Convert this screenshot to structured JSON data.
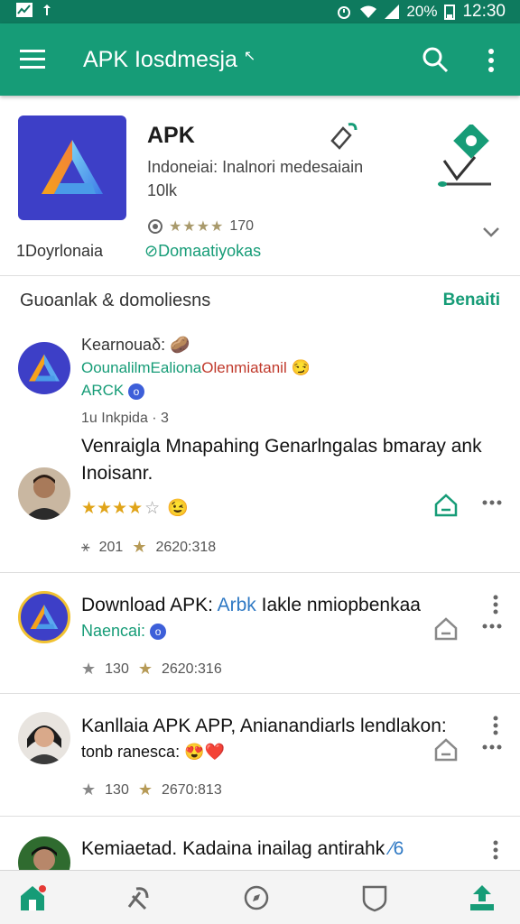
{
  "status": {
    "battery": "20%",
    "time": "12:30"
  },
  "appbar": {
    "title": "APK Iosdmesja",
    "title_mark": "↖"
  },
  "app_card": {
    "name": "APK",
    "subtitle": "Indoneiai: Inalnori medesaiain 10lk",
    "rating_value": "170",
    "downloads_label": "1Doyrlonaia",
    "downloads_link": "Domaatiyokas",
    "colors": {
      "accent": "#169c77",
      "icon_bg": "#3d3fc7"
    }
  },
  "section": {
    "label": "Guoanlak & domoliesns",
    "action": "Benaiti"
  },
  "posts": [
    {
      "name": "Kearnouaδ:",
      "author_a": "OounalilmEaliona",
      "author_b": "Olenmiatanil",
      "tag": "ARCK",
      "meta": "1u Inkpida · 3",
      "body": "Venraigla Mnapahing Genarlngalas bmaray ank Inoisanr.",
      "stat_a": "201",
      "stat_b": "2620:318"
    },
    {
      "headline_a": "Download APK:",
      "headline_b": "Arbk",
      "headline_c": "Iakle nmiopbenkaa",
      "author": "Naencai:",
      "stat_a": "130",
      "stat_b": "2620:316"
    },
    {
      "headline": "Kanllaia APK APP, Anianandiarls lendlakon:",
      "author": "tonb ranesca:",
      "stat_a": "130",
      "stat_b": "2670:813"
    },
    {
      "headline": "Kemiaetad. Kadaina inailag antirahk"
    }
  ],
  "icons": {
    "menu": "hamburger-icon",
    "search": "search-icon",
    "more": "more-vert-icon",
    "share": "share-icon",
    "home": "home-outline-icon",
    "nav": [
      "home-icon",
      "tools-icon",
      "compass-icon",
      "shield-icon",
      "upload-icon"
    ]
  }
}
